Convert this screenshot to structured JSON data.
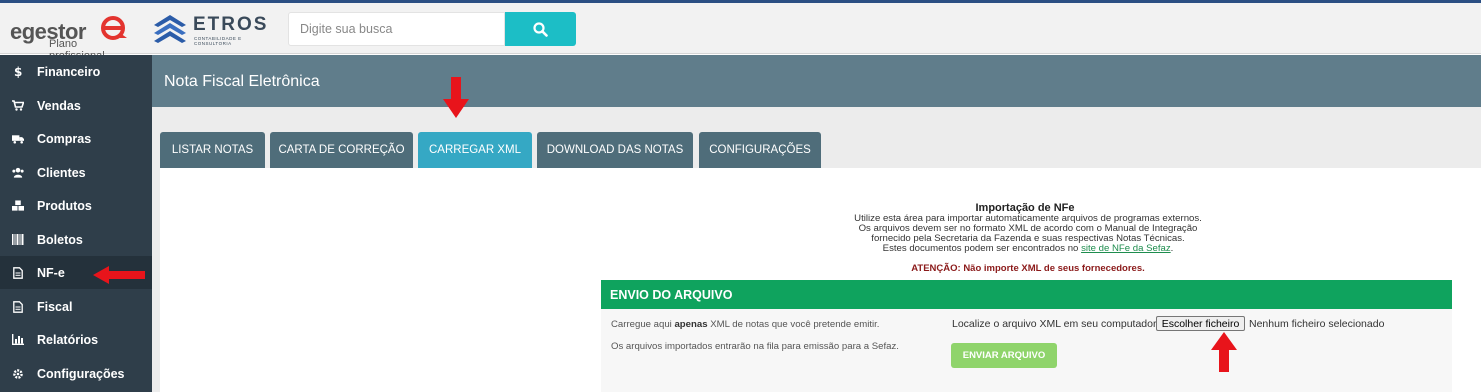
{
  "header": {
    "brand_name": "egestor",
    "brand_plan": "Plano profissional",
    "partner_name": "ETROS",
    "partner_tagline": "CONTABILIDADE E CONSULTORIA",
    "search_placeholder": "Digite sua busca"
  },
  "sidebar": {
    "items": [
      {
        "label": "Financeiro",
        "icon": "dollar-icon"
      },
      {
        "label": "Vendas",
        "icon": "cart-icon"
      },
      {
        "label": "Compras",
        "icon": "truck-icon"
      },
      {
        "label": "Clientes",
        "icon": "users-icon"
      },
      {
        "label": "Produtos",
        "icon": "cubes-icon"
      },
      {
        "label": "Boletos",
        "icon": "barcode-icon"
      },
      {
        "label": "NF-e",
        "icon": "document-icon"
      },
      {
        "label": "Fiscal",
        "icon": "document-icon"
      },
      {
        "label": "Relatórios",
        "icon": "bar-chart-icon"
      },
      {
        "label": "Configurações",
        "icon": "gear-icon"
      }
    ],
    "active": "NF-e"
  },
  "page": {
    "title": "Nota Fiscal Eletrônica",
    "tabs": [
      "LISTAR NOTAS",
      "CARTA DE CORREÇÃO",
      "CARREGAR XML",
      "DOWNLOAD DAS NOTAS",
      "CONFIGURAÇÕES"
    ],
    "active_tab": "CARREGAR XML"
  },
  "import": {
    "title": "Importação de NFe",
    "line1": "Utilize esta área para importar automaticamente arquivos de programas externos.",
    "line2": "Os arquivos devem ser no formato XML de acordo com o Manual de Integração",
    "line3": "fornecido pela Secretaria da Fazenda e suas respectivas Notas Técnicas.",
    "line4_prefix": "Estes documentos podem ser encontrados no ",
    "line4_link": "site de NFe da Sefaz",
    "line4_suffix": ".",
    "attention": "ATENÇÃO: Não importe XML de seus fornecedores."
  },
  "upload": {
    "header": "ENVIO DO ARQUIVO",
    "note1_prefix": "Carregue aqui ",
    "note1_bold": "apenas",
    "note1_suffix": " XML de notas que você pretende emitir.",
    "note2": "Os arquivos importados entrarão na fila para emissão para a Sefaz.",
    "file_label": "Localize o arquivo XML em seu computador",
    "file_button": "Escolher ficheiro",
    "file_status": "Nenhum ficheiro selecionado",
    "send_button": "ENVIAR ARQUIVO"
  },
  "colors": {
    "sidebar": "#2f3e4a",
    "title_bar": "#607d8b",
    "tab": "#4f6d7a",
    "tab_active": "#35a8c4",
    "search_button": "#1cbec6",
    "upload_header": "#0fa35e",
    "send_button": "#8fd46b",
    "annotation_arrow": "#e8141b"
  }
}
